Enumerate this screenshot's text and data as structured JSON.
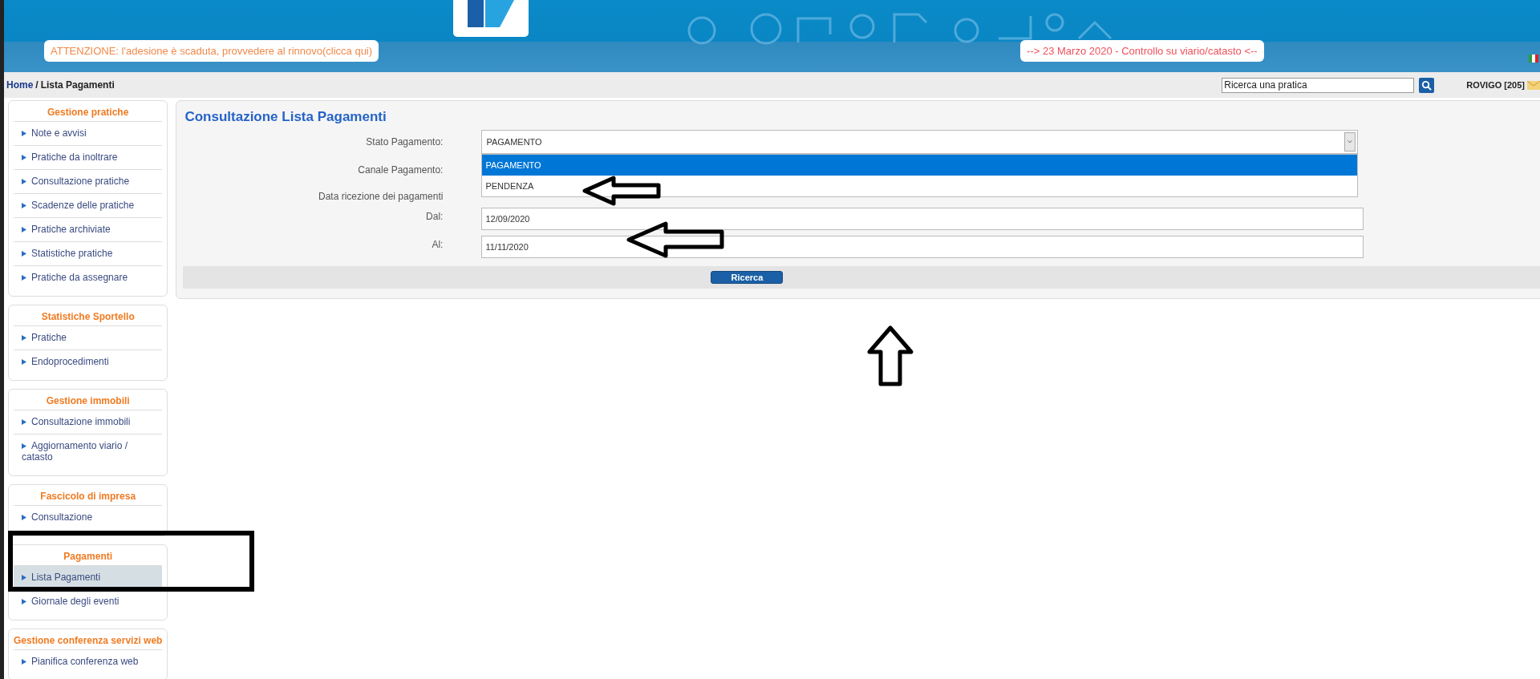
{
  "header": {
    "notices": [
      {
        "text": "ATTENZIONE: l'adesione è scaduta, provvedere al rinnovo(clicca qui)",
        "color": "#f08a4b"
      },
      {
        "text": "--> 23 Marzo 2020 - Controllo su viario/catasto <--",
        "color": "#f0505a"
      }
    ]
  },
  "breadcrumb": {
    "items": [
      {
        "label": "Home",
        "kind": "link"
      },
      {
        "label": "Lista Pagamenti",
        "kind": "current"
      }
    ],
    "separator": "/"
  },
  "search": {
    "placeholder": "Ricerca una pratica"
  },
  "user": {
    "label": "ROVIGO [205]"
  },
  "sidebar": {
    "groups": [
      {
        "title": "Gestione pratiche",
        "items": [
          {
            "label": "Note e avvisi",
            "selected": false
          },
          {
            "label": "Pratiche da inoltrare",
            "selected": false
          },
          {
            "label": "Consultazione pratiche",
            "selected": false
          },
          {
            "label": "Scadenze delle pratiche",
            "selected": false
          },
          {
            "label": "Pratiche archiviate",
            "selected": false
          },
          {
            "label": "Statistiche pratiche",
            "selected": false
          },
          {
            "label": "Pratiche da assegnare",
            "selected": false
          }
        ]
      },
      {
        "title": "Statistiche Sportello",
        "items": [
          {
            "label": "Pratiche",
            "selected": false
          },
          {
            "label": "Endoprocedimenti",
            "selected": false
          }
        ]
      },
      {
        "title": "Gestione immobili",
        "items": [
          {
            "label": "Consultazione immobili",
            "selected": false
          },
          {
            "label": "Aggiornamento viario / catasto",
            "selected": false
          }
        ]
      },
      {
        "title": "Fascicolo di impresa",
        "items": [
          {
            "label": "Consultazione",
            "selected": false
          }
        ]
      },
      {
        "title": "Pagamenti",
        "items": [
          {
            "label": "Lista Pagamenti",
            "selected": true
          },
          {
            "label": "Giornale degli eventi",
            "selected": false
          }
        ]
      },
      {
        "title": "Gestione conferenza servizi web",
        "items": [
          {
            "label": "Pianifica conferenza web",
            "selected": false
          }
        ]
      }
    ]
  },
  "main": {
    "title": "Consultazione Lista Pagamenti",
    "fields": [
      {
        "kind": "select",
        "label": "Stato Pagamento:",
        "value": "PAGAMENTO",
        "expanded": true,
        "options": [
          {
            "label": "PAGAMENTO",
            "selected": true
          },
          {
            "label": "PENDENZA",
            "selected": false
          }
        ]
      },
      {
        "kind": "covered",
        "label": "Canale Pagamento:"
      },
      {
        "kind": "heading",
        "label": "Data ricezione dei pagamenti"
      },
      {
        "kind": "text",
        "label": "Dal:",
        "value": "12/09/2020"
      },
      {
        "kind": "text",
        "label": "Al:",
        "value": "11/11/2020"
      }
    ],
    "button": "Ricerca"
  }
}
